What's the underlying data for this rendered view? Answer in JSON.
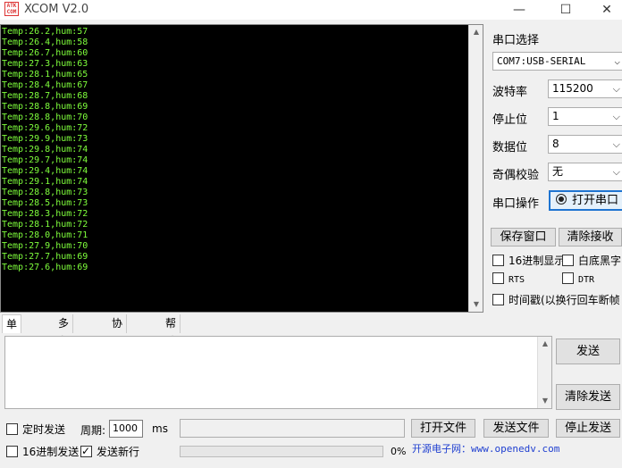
{
  "window": {
    "logo_text": "ATK COM",
    "title": "XCOM V2.0",
    "minimize_glyph": "—",
    "maximize_glyph": "☐",
    "close_glyph": "✕"
  },
  "terminal": {
    "lines": [
      "Temp:26.2,hum:57",
      "Temp:26.4,hum:58",
      "Temp:26.7,hum:60",
      "Temp:27.3,hum:63",
      "Temp:28.1,hum:65",
      "Temp:28.4,hum:67",
      "Temp:28.7,hum:68",
      "Temp:28.8,hum:69",
      "Temp:28.8,hum:70",
      "Temp:29.6,hum:72",
      "Temp:29.9,hum:73",
      "Temp:29.8,hum:74",
      "Temp:29.7,hum:74",
      "Temp:29.4,hum:74",
      "Temp:29.1,hum:74",
      "Temp:28.8,hum:73",
      "Temp:28.5,hum:73",
      "Temp:28.3,hum:72",
      "Temp:28.1,hum:72",
      "Temp:28.0,hum:71",
      "Temp:27.9,hum:70",
      "Temp:27.7,hum:69",
      "Temp:27.6,hum:69"
    ],
    "text_color": "#7fff3c"
  },
  "serial": {
    "port_label": "串口选择",
    "port_value": "COM7:USB-SERIAL",
    "baud_label": "波特率",
    "baud_value": "115200",
    "stopbits_label": "停止位",
    "stopbits_value": "1",
    "databits_label": "数据位",
    "databits_value": "8",
    "parity_label": "奇偶校验",
    "parity_value": "无",
    "operation_label": "串口操作",
    "open_button": "打开串口"
  },
  "receive": {
    "save_button": "保存窗口",
    "clear_button": "清除接收",
    "hex_display_label": "16进制显示",
    "white_bg_label": "白底黑字",
    "rts_label": "RTS",
    "dtr_label": "DTR",
    "timestamp_label": "时间戳(以换行回车断帧"
  },
  "tabs": [
    {
      "label": "单条发送",
      "active": true
    },
    {
      "label": "多条发送",
      "active": false
    },
    {
      "label": "协议传输",
      "active": false
    },
    {
      "label": "帮助",
      "active": false
    }
  ],
  "send": {
    "send_button": "发送",
    "clear_send_button": "清除发送",
    "timed_send_label": "定时发送",
    "period_label": "周期:",
    "period_value": "1000",
    "period_unit": "ms",
    "open_file_button": "打开文件",
    "send_file_button": "发送文件",
    "stop_send_button": "停止发送",
    "hex_send_label": "16进制发送",
    "newline_label": "发送新行",
    "progress_text": "0%",
    "progress_value": 0,
    "url_banner": "开源电子网：www.openedv.com"
  },
  "colors": {
    "accent": "#1e74d1",
    "terminal_bg": "#000000",
    "url_color": "#1f3fd0"
  }
}
